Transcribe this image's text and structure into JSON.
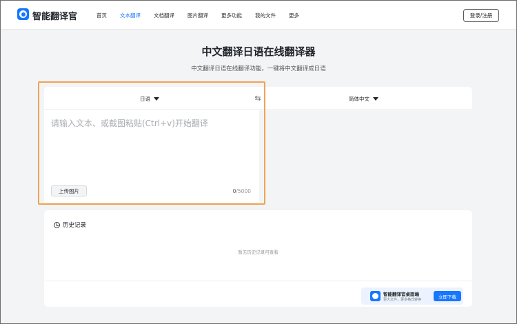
{
  "header": {
    "brand": "智能翻译官",
    "nav": [
      "首页",
      "文本翻译",
      "文档翻译",
      "图片翻译",
      "更多功能",
      "我的文件",
      "更多"
    ],
    "active_nav": 1,
    "login_label": "登录/注册"
  },
  "hero": {
    "title": "中文翻译日语在线翻译器",
    "subtitle": "中文翻译日语在线翻译功能，一键将中文翻译成日语"
  },
  "translator": {
    "source_lang": "日语",
    "target_lang": "简体中文",
    "input_value": "",
    "input_placeholder": "请输入文本、或截图粘贴(Ctrl+v)开始翻译",
    "upload_label": "上传图片",
    "char_count": "0",
    "char_limit": "/5000"
  },
  "history": {
    "title": "历史记录",
    "empty_text": "暂无历史记录可查看",
    "promo_title": "智能翻译官桌面端",
    "promo_subtitle": "更大文件，更多格式转换",
    "promo_button": "立即下载"
  },
  "colors": {
    "accent": "#1677ff",
    "highlight": "#f0a352"
  },
  "icons": {
    "brand_logo": "app-logo-icon",
    "swap": "swap-arrows-icon",
    "dropdown": "caret-down-icon",
    "history": "history-clock-icon"
  }
}
